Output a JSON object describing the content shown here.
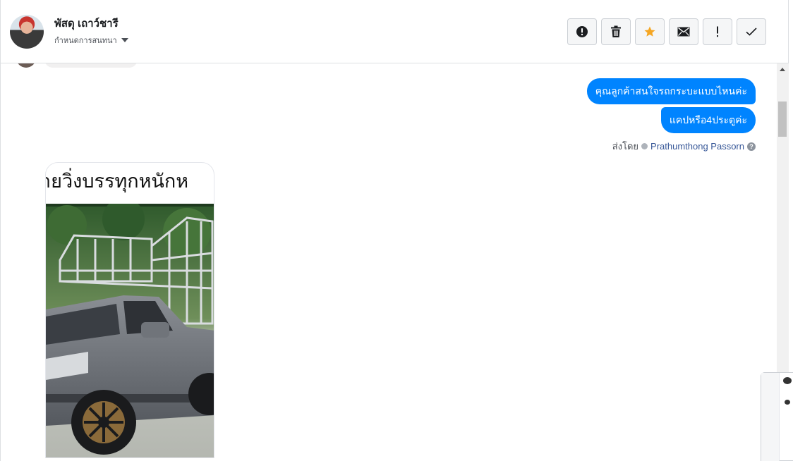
{
  "header": {
    "contact_name": "พัสดุ เถาว์ชารี",
    "assign_label": "กำหนดการสนทนา",
    "toolbar": [
      {
        "name": "report-spam-button",
        "icon": "exclamation-circle-icon",
        "color": "#1c1e21"
      },
      {
        "name": "delete-button",
        "icon": "trash-icon",
        "color": "#1c1e21"
      },
      {
        "name": "star-button",
        "icon": "star-icon",
        "color": "#f5a623"
      },
      {
        "name": "mark-unread-button",
        "icon": "envelope-icon",
        "color": "#1c1e21"
      },
      {
        "name": "follow-up-button",
        "icon": "exclamation-icon",
        "color": "#1c1e21"
      },
      {
        "name": "mark-done-button",
        "icon": "checkmark-icon",
        "color": "#1c1e21"
      }
    ]
  },
  "messages": {
    "outgoing": [
      "คุณลูกค้าสนใจรถกระบะแบบไหนค่ะ",
      "แคปหรือ4ประตูค่ะ"
    ],
    "sent_by_label": "ส่งโดย",
    "sender_name": "Prathumthong Passorn",
    "media_caption": "ายวิ่งบรรทุกหนักห"
  },
  "colors": {
    "bubble_blue": "#0084ff",
    "link_blue": "#385898"
  }
}
